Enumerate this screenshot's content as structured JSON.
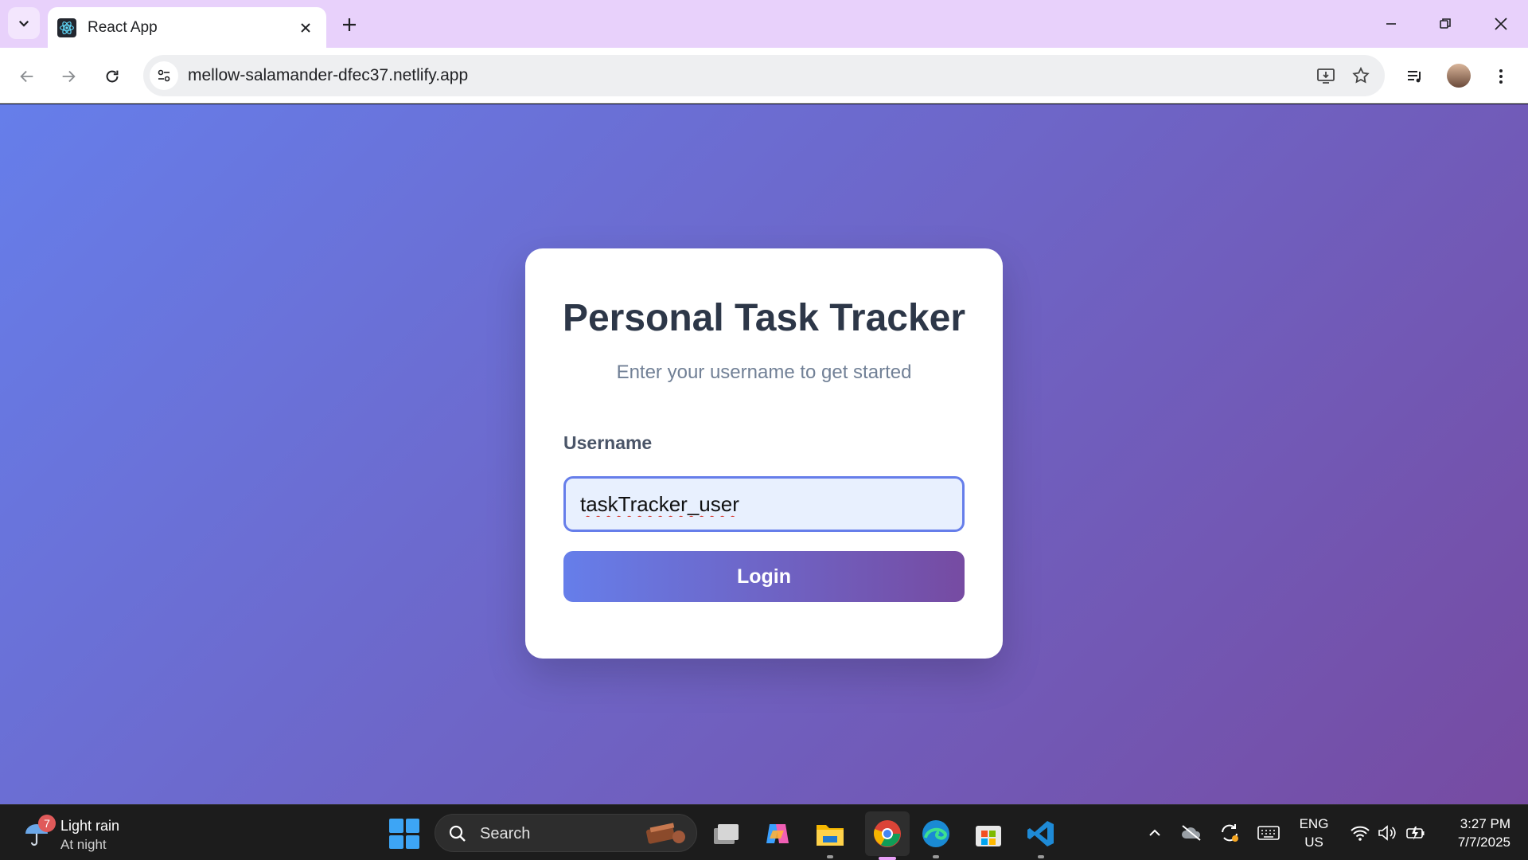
{
  "browser": {
    "tab_title": "React App",
    "url": "mellow-salamander-dfec37.netlify.app"
  },
  "card": {
    "title": "Personal Task Tracker",
    "subtitle": "Enter your username to get started",
    "username_label": "Username",
    "username_value": "taskTracker_user",
    "login_label": "Login"
  },
  "taskbar": {
    "weather_badge": "7",
    "weather_line1": "Light rain",
    "weather_line2": "At night",
    "search_label": "Search",
    "lang_line1": "ENG",
    "lang_line2": "US",
    "time": "3:27 PM",
    "date": "7/7/2025"
  },
  "colors": {
    "gradient_start": "#667eea",
    "gradient_end": "#764ba2",
    "tab_strip": "#e8d1fb"
  }
}
